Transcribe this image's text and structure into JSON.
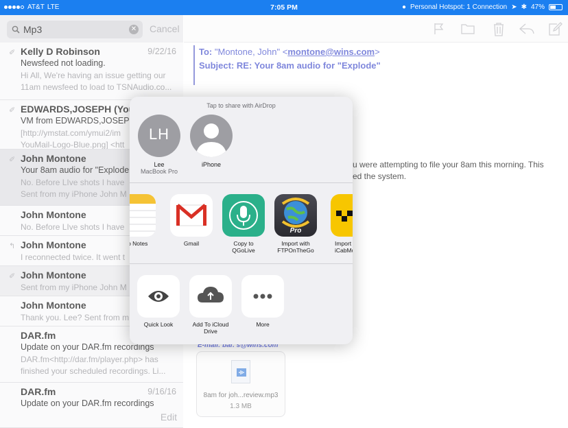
{
  "status_bar": {
    "carrier": "AT&T",
    "network": "LTE",
    "time": "7:05 PM",
    "hotspot": "Personal Hotspot: 1 Connection",
    "battery": "47%",
    "battery_level": 0.47
  },
  "search": {
    "value": "Mp3",
    "cancel_label": "Cancel"
  },
  "messages": [
    {
      "sender": "Kelly D Robinson",
      "date": "9/22/16",
      "subject": "Newsfeed not loading.",
      "preview": [
        "Hi All, We're having an issue getting our",
        "11am newsfeed to load to TSNAudio.co..."
      ],
      "icon": "attachment-icon"
    },
    {
      "sender": "EDWARDS,JOSEPH (You",
      "date": "",
      "subject": "VM from EDWARDS,JOSEPH",
      "preview": [
        "[http://ymstat.com/ymui2/im",
        "YouMail-Logo-Blue.png] <htt"
      ],
      "icon": "attachment-icon"
    },
    {
      "sender": "John Montone",
      "date": "",
      "subject": "Your 8am audio for \"Explode",
      "preview": [
        "No. Before LIve shots I have",
        "Sent from my iPhone John M"
      ],
      "icon": "attachment-icon"
    },
    {
      "sender": "John Montone",
      "date": "",
      "subject": "",
      "preview": [
        "No. Before LIve shots I have"
      ],
      "icon": ""
    },
    {
      "sender": "John Montone",
      "date": "",
      "subject": "",
      "preview": [
        "I reconnected twice. It went t"
      ],
      "icon": "reply-icon"
    },
    {
      "sender": "John Montone",
      "date": "",
      "subject": "",
      "preview": [
        "Sent from my iPhone John M"
      ],
      "icon": "attachment-icon"
    },
    {
      "sender": "John Montone",
      "date": "",
      "subject": "",
      "preview": [
        "Thank you. Lee? Sent from m"
      ],
      "icon": ""
    },
    {
      "sender": "DAR.fm",
      "date": "",
      "subject": "Update on your DAR.fm recordings",
      "preview": [
        "DAR.fm<http://dar.fm/player.php> has",
        "finished your scheduled recordings. Li..."
      ],
      "icon": ""
    },
    {
      "sender": "DAR.fm",
      "date": "9/16/16",
      "subject": "Update on your DAR.fm recordings",
      "preview": [],
      "icon": ""
    }
  ],
  "edit_label": "Edit",
  "email": {
    "to_label": "To:",
    "to_value": "\"Montone, John\" <",
    "to_link": "montone@wins.com",
    "to_end": ">",
    "subject_label": "Subject:",
    "subject_value": "RE:  Your 8am audio for \"Explode\"",
    "body_line1": "u were attempting to file your 8am this morning.  This",
    "body_line2": "ed the system.",
    "email_link": "E-mail:  bar.   s@wins.com",
    "attachment_name": "8am for joh...review.mp3",
    "attachment_size": "1.3 MB"
  },
  "share_sheet": {
    "airdrop_title": "Tap to share with AirDrop",
    "airdrop_targets": [
      {
        "initials": "LH",
        "name": "Lee",
        "device": "MacBook Pro"
      },
      {
        "initials": "",
        "name": "iPhone",
        "device": ""
      }
    ],
    "apps": [
      {
        "label": "d to Notes",
        "icon": "notes-icon"
      },
      {
        "label": "Gmail",
        "icon": "gmail-icon"
      },
      {
        "label": "Copy to\nQGoLive",
        "icon": "microphone-icon"
      },
      {
        "label": "Import with\nFTPOnTheGo",
        "icon": "ftp-globe-icon",
        "badge": "Pro"
      },
      {
        "label": "Import\niCabMo",
        "icon": "cab-icon"
      }
    ],
    "actions": [
      {
        "label": "Quick Look",
        "icon": "eye-icon"
      },
      {
        "label": "Add To iCloud\nDrive",
        "icon": "icloud-upload-icon"
      },
      {
        "label": "More",
        "icon": "more-icon"
      }
    ]
  },
  "colors": {
    "status_bar": "#1b7ff0",
    "email_blue": "#3b47c9",
    "gmail_red": "#d93025",
    "qgolive_green": "#2bb08a",
    "cab_yellow": "#f7c600"
  }
}
